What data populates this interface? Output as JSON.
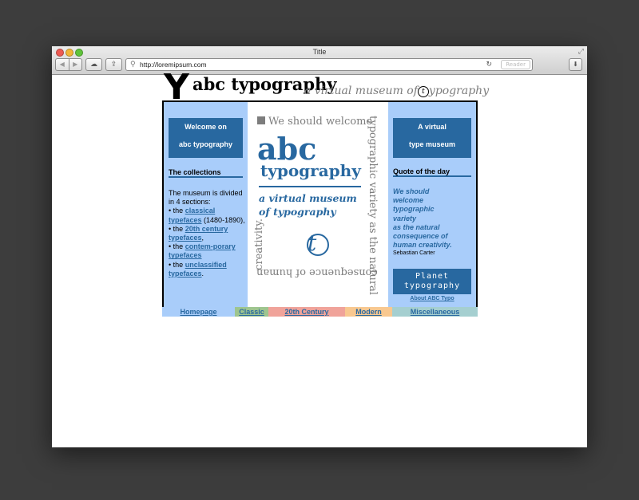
{
  "browser": {
    "title": "Title",
    "url": "http://loremipsum.com",
    "reader_label": "Reader"
  },
  "site": {
    "logo_letter": "Y",
    "title": "abc typography",
    "subtitle_before": "a virtual museum of",
    "subtitle_mark": "t",
    "subtitle_after": "ypography"
  },
  "left": {
    "welcome_line1": "Welcome on",
    "welcome_line2": "abc typography",
    "heading": "The collections",
    "intro": "The museum is divided in 4 sections:",
    "bullet": "•",
    "item1_prefix": "the",
    "item1_link": "classical typefaces",
    "item1_suffix": "(1480-1890),",
    "item2_prefix": "the",
    "item2_link": "20th century typefaces",
    "item2_suffix": ",",
    "item3_prefix": "the",
    "item3_link": "contem-porary typefaces",
    "item4_prefix": "the",
    "item4_link": "unclassified typefaces",
    "item4_suffix": "."
  },
  "center": {
    "top_text": "We should welcome",
    "right_text": "typographic variety as the natural",
    "bottom_text": "consequence of human",
    "left_text": "creativity.",
    "abc": "abc",
    "typography": "typography",
    "museum_line1": "a virtual museum",
    "museum_line2": "of typography",
    "logo_letter": "t"
  },
  "right": {
    "box_line1": "A virtual",
    "box_line2": "type museum",
    "heading": "Quote of the day",
    "quote_line1": "We should",
    "quote_line2": "welcome",
    "quote_line3": "typographic",
    "quote_line4": "variety",
    "quote_line5": "as the natural",
    "quote_line6": "consequence of",
    "quote_line7": "human creativity.",
    "author": "Sebastian Carter",
    "planet_line1": "Planet",
    "planet_line2": "typography",
    "about_link": "About ABC Typo"
  },
  "nav": [
    {
      "label": "Homepage",
      "color": "#a9cdfa"
    },
    {
      "label": "Classic",
      "color": "#9ec58f"
    },
    {
      "label": "20th Century",
      "color": "#f0a39a"
    },
    {
      "label": "Modern",
      "color": "#f8c890"
    },
    {
      "label": "Miscellaneous",
      "color": "#a5cfd0"
    }
  ],
  "colors": {
    "accent_blue": "#2868a0",
    "column_blue": "#a9cdfa",
    "gray_text": "#7d7d7d"
  }
}
